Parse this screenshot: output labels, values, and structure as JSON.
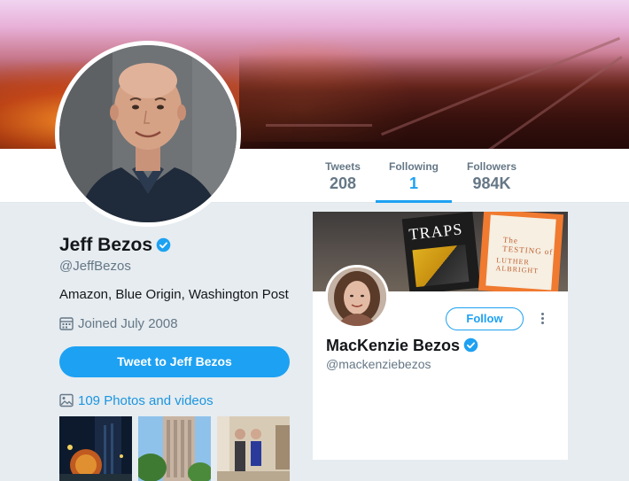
{
  "profile": {
    "name": "Jeff Bezos",
    "handle": "@JeffBezos",
    "bio": "Amazon, Blue Origin, Washington Post",
    "joined": "Joined July 2008",
    "tweet_to_label": "Tweet to Jeff Bezos",
    "photos_label": "109 Photos and videos"
  },
  "stats": [
    {
      "label": "Tweets",
      "value": "208"
    },
    {
      "label": "Following",
      "value": "1"
    },
    {
      "label": "Followers",
      "value": "984K"
    }
  ],
  "following_card": {
    "name": "MacKenzie Bezos",
    "handle": "@mackenziebezos",
    "follow_label": "Follow",
    "book1_title": "TRAPS",
    "book2_title": "The TESTING of",
    "book2_subtitle": "LUTHER ALBRIGHT"
  },
  "colors": {
    "accent": "#1da1f2",
    "text_secondary": "#657786",
    "background": "#e6ecf0"
  }
}
